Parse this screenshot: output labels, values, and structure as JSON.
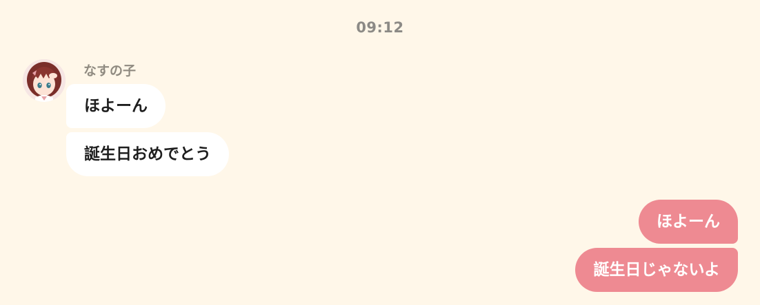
{
  "chat": {
    "timestamp": "09:12",
    "sender": {
      "name": "なすの子",
      "avatar_icon": "avatar-girl-portrait"
    },
    "incoming_messages": [
      {
        "text": "ほよーん"
      },
      {
        "text": "誕生日おめでとう"
      }
    ],
    "outgoing_messages": [
      {
        "text": "ほよーん"
      },
      {
        "text": "誕生日じゃないよ"
      }
    ]
  },
  "colors": {
    "background": "#fff7e9",
    "incoming_bubble": "#ffffff",
    "outgoing_bubble": "#ee8a92",
    "timestamp_text": "#8c8a86"
  }
}
